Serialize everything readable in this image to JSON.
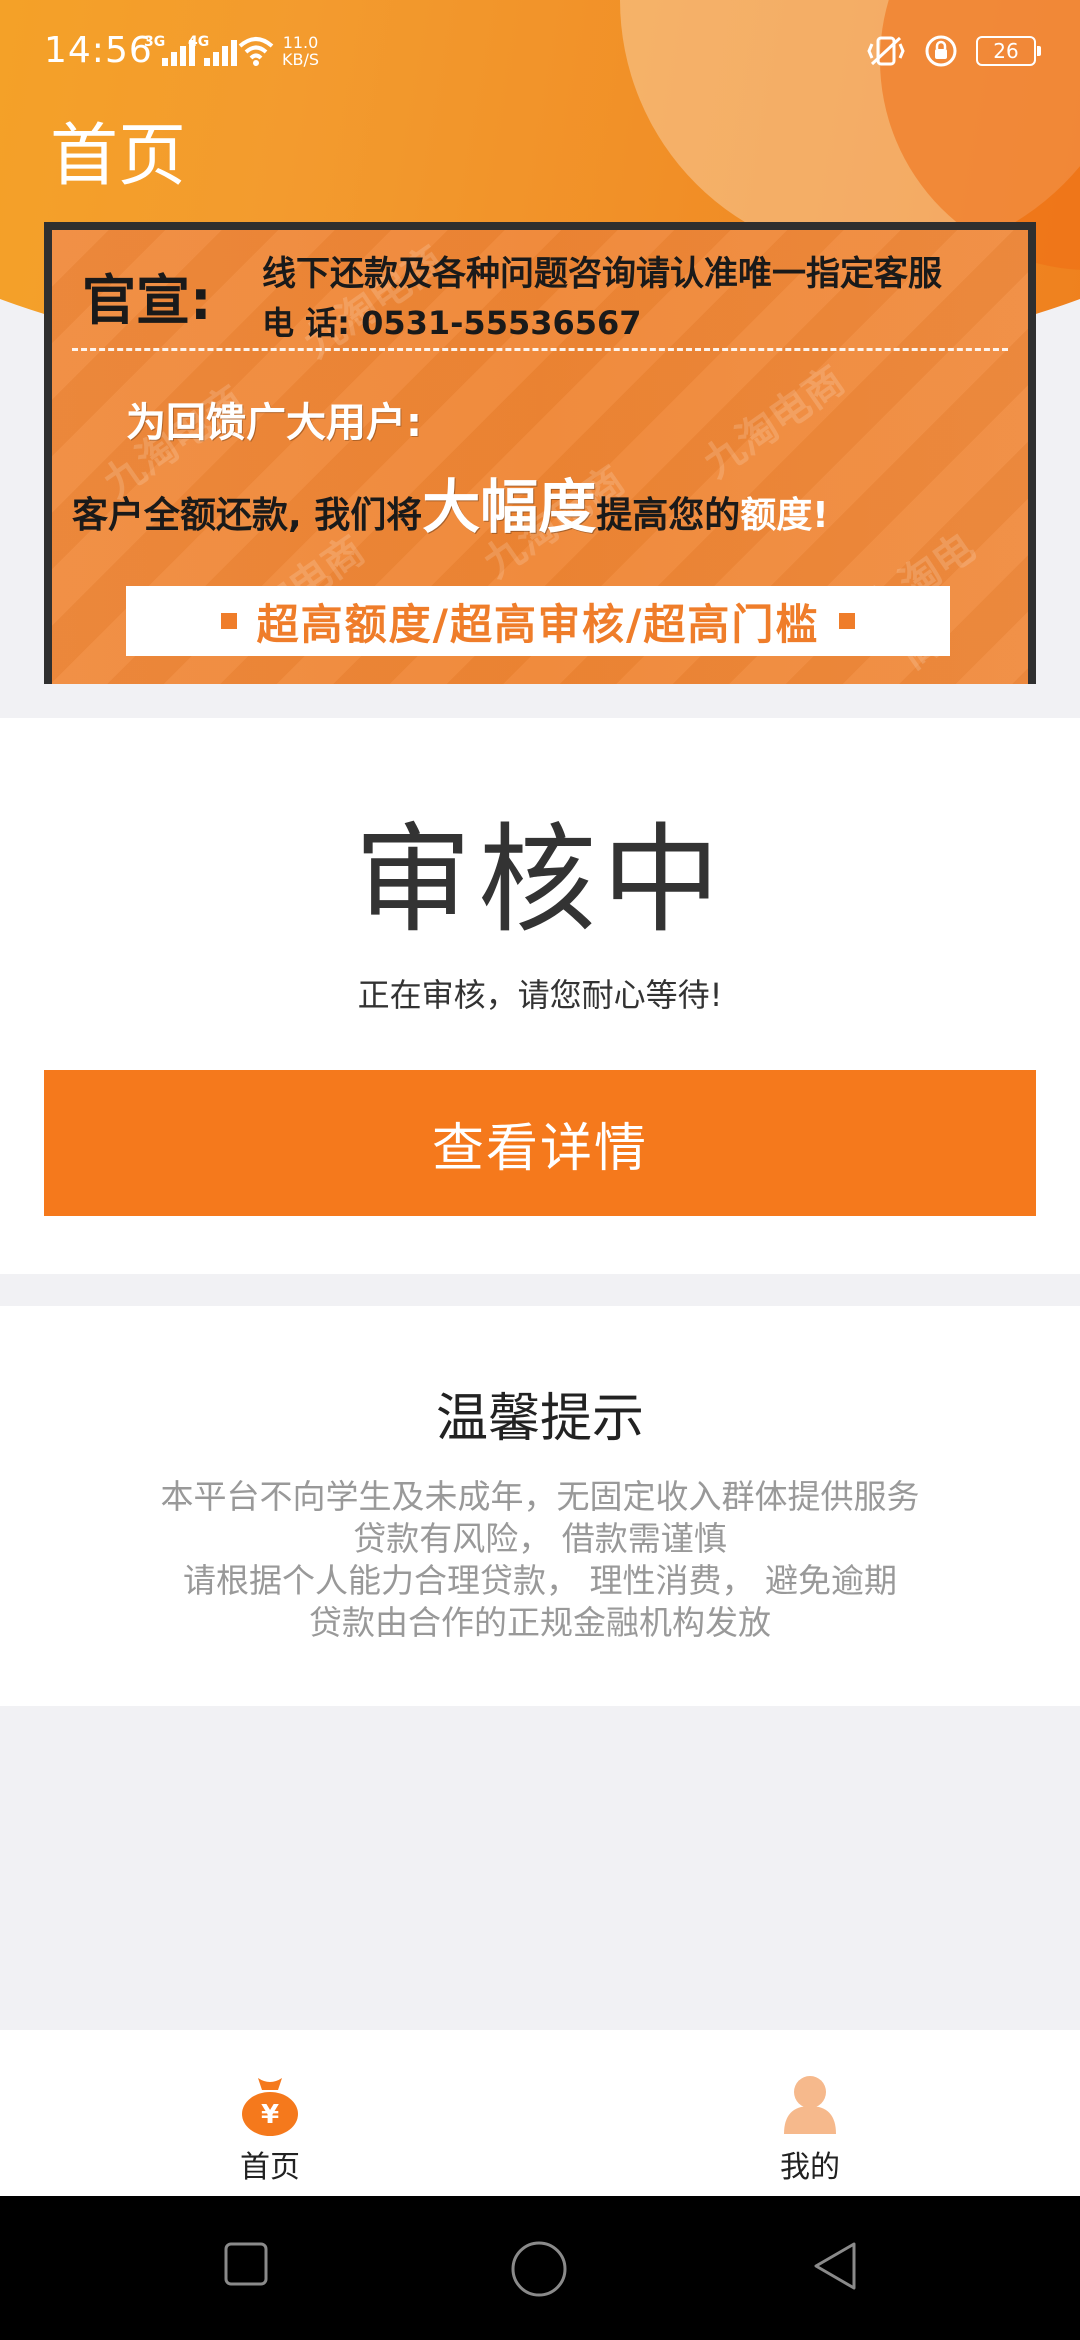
{
  "status_bar": {
    "time": "14:56",
    "sim1": "3G",
    "sim2": "4G",
    "speed_value": "11.0",
    "speed_unit": "KB/S",
    "battery": "26"
  },
  "header": {
    "title": "首页"
  },
  "banner": {
    "heading": "官宣:",
    "notice": "线下还款及各种问题咨询请认准唯一指定客服",
    "phone": "电 话: 0531-55536567",
    "feedback": "为回馈广大用户:",
    "promo_pre": "客户全额还款, 我们将",
    "promo_big": "大幅度",
    "promo_mid": "提高您的",
    "promo_end": "额度!",
    "strip": "超高额度/超高审核/超高门槛",
    "watermark": "九淘电商"
  },
  "review": {
    "status": "审核中",
    "message": "正在审核，请您耐心等待!",
    "details_button": "查看详情"
  },
  "tips": {
    "title": "温馨提示",
    "lines": [
      "本平台不向学生及未成年，无固定收入群体提供服务",
      "贷款有风险， 借款需谨慎",
      "请根据个人能力合理贷款， 理性消费， 避免逾期",
      "贷款由合作的正规金融机构发放"
    ]
  },
  "bottom_nav": {
    "items": [
      {
        "label": "首页",
        "icon": "money-bag-icon"
      },
      {
        "label": "我的",
        "icon": "person-icon"
      }
    ]
  },
  "colors": {
    "accent": "#f5791c",
    "header": "#f39b2e",
    "inactive_icon": "#f6b98c"
  }
}
